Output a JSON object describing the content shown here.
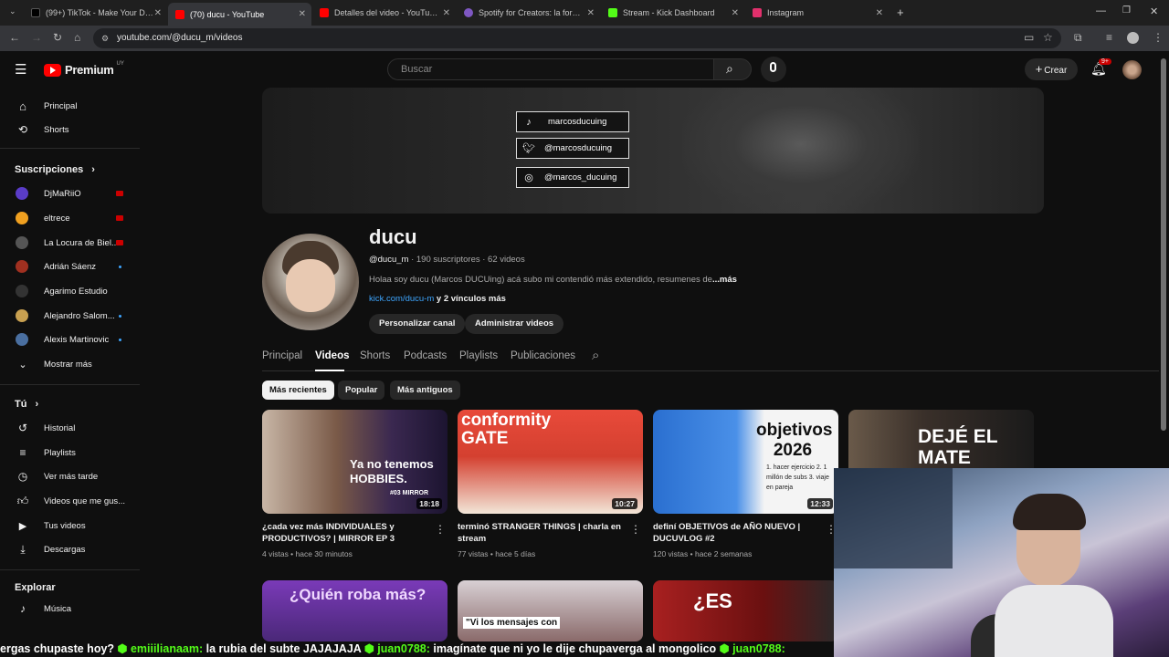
{
  "browser": {
    "tabs": [
      {
        "label": "(99+) TikTok - Make Your Day",
        "color": "#000000"
      },
      {
        "label": "(70) ducu - YouTube",
        "color": "#ff0000",
        "active": true
      },
      {
        "label": "Detalles del video - YouTube St",
        "color": "#ff0000"
      },
      {
        "label": "Spotify for Creators: la forma m",
        "color": "#7e57c2"
      },
      {
        "label": "Stream - Kick Dashboard",
        "color": "#53fc18"
      },
      {
        "label": "Instagram",
        "color": "#e1306c"
      }
    ],
    "url": "youtube.com/@ducu_m/videos"
  },
  "header": {
    "logo_text": "Premium",
    "logo_region": "UY",
    "search_placeholder": "Buscar",
    "create_label": "Crear",
    "notif_badge": "9+"
  },
  "sidebar": {
    "main": [
      {
        "label": "Principal",
        "icon": "home-icon"
      },
      {
        "label": "Shorts",
        "icon": "shorts-icon"
      }
    ],
    "subscriptions_title": "Suscripciones",
    "subscriptions": [
      {
        "label": "DjMaRiiO",
        "color": "#5a3cc8",
        "status": "live"
      },
      {
        "label": "eltrece",
        "color": "#f0a020",
        "status": "live"
      },
      {
        "label": "La Locura de Biel...",
        "color": "#555555",
        "status": "live"
      },
      {
        "label": "Adrián Sáenz",
        "color": "#a03020",
        "status": "new"
      },
      {
        "label": "Agarimo Estudio",
        "color": "#333333",
        "status": "none"
      },
      {
        "label": "Alejandro Salom...",
        "color": "#c8a050",
        "status": "new"
      },
      {
        "label": "Alexis Martinovic",
        "color": "#4a6fa0",
        "status": "new"
      },
      {
        "label": "Mostrar más",
        "color": "",
        "status": "none"
      }
    ],
    "you_title": "Tú",
    "you": [
      {
        "label": "Historial",
        "icon": "history-icon"
      },
      {
        "label": "Playlists",
        "icon": "playlists-icon"
      },
      {
        "label": "Ver más tarde",
        "icon": "watch-later-icon"
      },
      {
        "label": "Videos que me gus...",
        "icon": "thumbs-up-icon"
      },
      {
        "label": "Tus videos",
        "icon": "your-videos-icon"
      },
      {
        "label": "Descargas",
        "icon": "download-icon"
      }
    ],
    "explore_title": "Explorar",
    "explore": [
      {
        "label": "Música",
        "icon": "music-icon"
      }
    ]
  },
  "channel": {
    "socials": [
      "marcosducuing",
      "@marcosducuing",
      "@marcos_ducuing"
    ],
    "name": "ducu",
    "handle": "@ducu_m",
    "stats": "· 190 suscriptores · 62 videos",
    "description": "Holaa soy ducu (Marcos DUCUing) acá subo mi contendió más extendido, resumenes de",
    "more": "...más",
    "link": "kick.com/ducu-m",
    "link_extra": " y 2 vínculos más",
    "btn_customize": "Personalizar canal",
    "btn_manage": "Administrar videos"
  },
  "tabs": [
    "Principal",
    "Videos",
    "Shorts",
    "Podcasts",
    "Playlists",
    "Publicaciones"
  ],
  "chips": [
    "Más recientes",
    "Popular",
    "Más antiguos"
  ],
  "videos": [
    {
      "title": "¿cada vez más INDIVIDUALES y PRODUCTIVOS? | MIRROR EP 3",
      "meta": "4 vistas • hace 30 minutos",
      "duration": "18:18",
      "thumb_text": "Ya no tenemos HOBBIES.",
      "thumb_tag": "#03 MIRROR"
    },
    {
      "title": "terminó STRANGER THINGS | charla en stream",
      "meta": "77 vistas • hace 5 días",
      "duration": "10:27",
      "thumb_text": "conformity GATE",
      "thumb_tag": ""
    },
    {
      "title": "definí OBJETIVOS de AÑO NUEVO | DUCUVLOG #2",
      "meta": "120 vistas • hace 2 semanas",
      "duration": "12:33",
      "thumb_text": "objetivos 2026",
      "thumb_tag": "1. hacer ejercicio 2. 1 millón de subs 3. viaje en pareja"
    },
    {
      "title": "",
      "meta": "",
      "duration": "",
      "thumb_text": "DEJÉ EL MATE",
      "thumb_tag": ""
    }
  ],
  "row2_thumbs": [
    "¿Quién roba más?",
    "\"Vi los mensajes con",
    "¿ES"
  ],
  "ticker": [
    {
      "user": "",
      "text": "ergas chupaste hoy?"
    },
    {
      "user": "emiiilianaam:",
      "text": " la rubia del subte JAJAJAJA"
    },
    {
      "user": "juan0788:",
      "text": " imagínate que ni yo le dije chupaverga al mongolico"
    },
    {
      "user": "juan0788:",
      "text": ""
    }
  ]
}
